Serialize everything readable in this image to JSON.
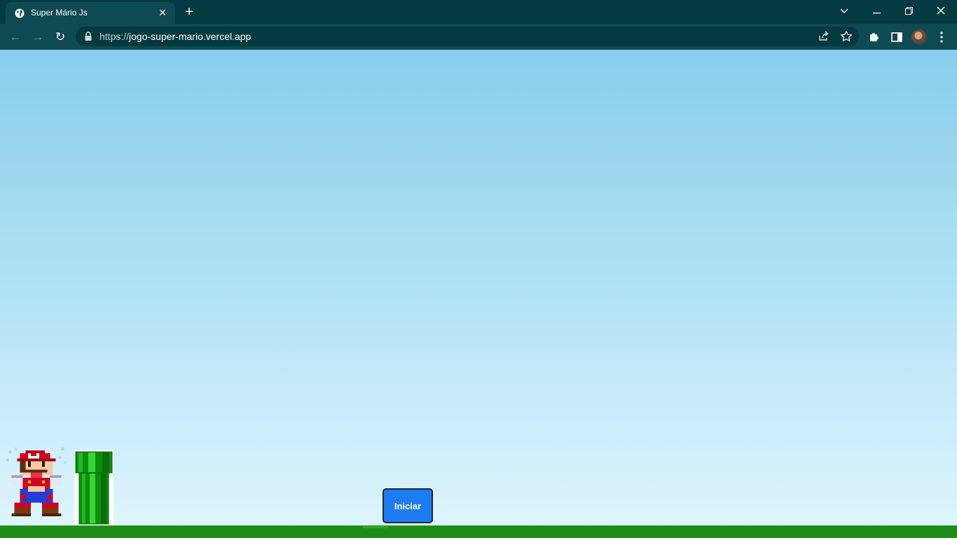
{
  "browser": {
    "tab": {
      "title": "Super Mário Js",
      "favicon": "globe-icon"
    },
    "new_tab_label": "+",
    "window_controls": {
      "tabs_menu": "⌄",
      "minimize": "—",
      "restore": "❐",
      "close": "✕"
    },
    "nav": {
      "back": "←",
      "forward": "→",
      "reload": "↻"
    },
    "url": {
      "scheme": "https://",
      "host": "jogo-super-mario.vercel.app"
    },
    "omnibox_icons": [
      "share-icon",
      "bookmark-star-icon"
    ],
    "toolbar_icons": [
      "extensions-puzzle-icon",
      "side-panel-icon",
      "profile-avatar",
      "more-menu-icon"
    ]
  },
  "game": {
    "start_button_label": "Iniciar",
    "sky_colors": [
      "#87ceeb",
      "#e0f6ff"
    ],
    "ground_color": "#1f8c1a",
    "pipe_color": "#0f9f0f",
    "button_color": "#1e7cf2"
  }
}
